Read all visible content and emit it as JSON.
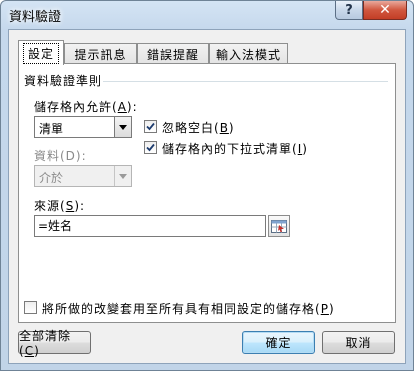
{
  "window": {
    "title": "資料驗證",
    "help_glyph": "?",
    "close_glyph": "✕"
  },
  "tabs": [
    {
      "label": "設定",
      "active": true
    },
    {
      "label": "提示訊息",
      "active": false
    },
    {
      "label": "錯誤提醒",
      "active": false
    },
    {
      "label": "輸入法模式",
      "active": false
    }
  ],
  "criteria": {
    "group_title": "資料驗證準則",
    "allow_label": "儲存格內允許(",
    "allow_key": "A",
    "allow_label_end": "):",
    "allow_value": "清單",
    "data_label": "資料(D):",
    "data_value": "介於",
    "ignore_blank_label": "忽略空白(",
    "ignore_blank_key": "B",
    "ignore_blank_end": ")",
    "ignore_blank_checked": true,
    "dropdown_label": "儲存格內的下拉式清單(",
    "dropdown_key": "I",
    "dropdown_end": ")",
    "dropdown_checked": true,
    "source_label": "來源(",
    "source_key": "S",
    "source_label_end": "):",
    "source_value": "=姓名"
  },
  "apply_all": {
    "label": "將所做的改變套用至所有具有相同設定的儲存格(",
    "key": "P",
    "end": ")",
    "checked": false
  },
  "buttons": {
    "clear_all": "全部清除(",
    "clear_all_key": "C",
    "clear_all_end": ")",
    "ok": "確定",
    "cancel": "取消"
  }
}
